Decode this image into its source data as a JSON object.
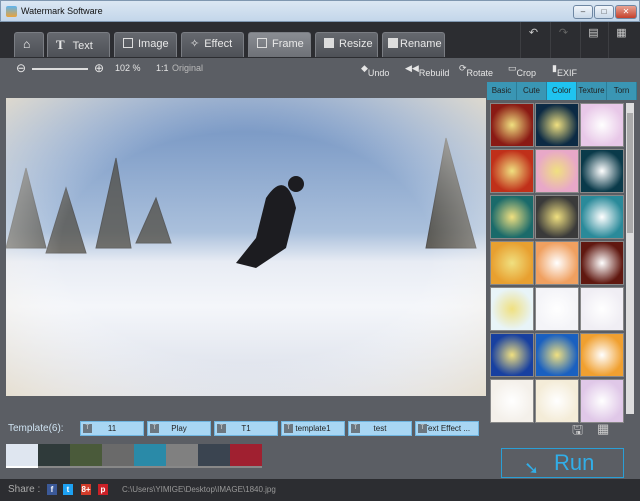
{
  "window": {
    "title": "Watermark Software",
    "min": "–",
    "max": "□",
    "close": "✕"
  },
  "tabs": [
    {
      "label": "",
      "icon": "home-icon"
    },
    {
      "label": "Text",
      "icon": "text-icon"
    },
    {
      "label": "Image",
      "icon": "image-icon"
    },
    {
      "label": "Effect",
      "icon": "wand-icon"
    },
    {
      "label": "Frame",
      "icon": "frame-icon"
    },
    {
      "label": "Resize",
      "icon": "resize-icon"
    },
    {
      "label": "Rename",
      "icon": "rename-icon"
    }
  ],
  "toolbar_right": [
    "↶",
    "↷",
    "▤",
    "▦"
  ],
  "zoom": {
    "value": "102 %",
    "original": "Original",
    "ratio_icon": "1:1"
  },
  "actions": {
    "undo": "Undo",
    "rebuild": "Rebuild",
    "rotate": "Rotate",
    "crop": "Crop",
    "exif": "EXIF"
  },
  "panel_tabs": [
    "Basic",
    "Cute",
    "Color",
    "Texture",
    "Torn"
  ],
  "active_panel_tab": "Color",
  "frame_colors": [
    "#8a1a14",
    "#0c2a44",
    "#e8c8e8",
    "#c0301a",
    "#e8a8c8",
    "#0a3a4a",
    "#1a6a6a",
    "#3a3a3a",
    "#2a8a9a",
    "#e8a030",
    "#f0a060",
    "#601810",
    "#e8f4f8",
    "#f4f4f8",
    "#f0eef4",
    "#1840a0",
    "#1a60c0",
    "#f0a030",
    "#f4f0ea",
    "#f4ecd8",
    "#e0c8e8"
  ],
  "template": {
    "label": "Template(6):",
    "items": [
      "11",
      "Play",
      "T1",
      "template1",
      "test",
      "Text Effect ..."
    ]
  },
  "film_colors": [
    "#dfe6f0",
    "#2f3a3a",
    "#4a5a3a",
    "#6a6a6a",
    "#2a8aa8",
    "#808080",
    "#3a4450",
    "#a02030"
  ],
  "run_label": "Run",
  "share": {
    "label": "Share :",
    "networks": [
      "f",
      "t",
      "8+",
      "p"
    ],
    "path": "C:\\Users\\YIMIGE\\Desktop\\IMAGE\\1840.jpg"
  }
}
